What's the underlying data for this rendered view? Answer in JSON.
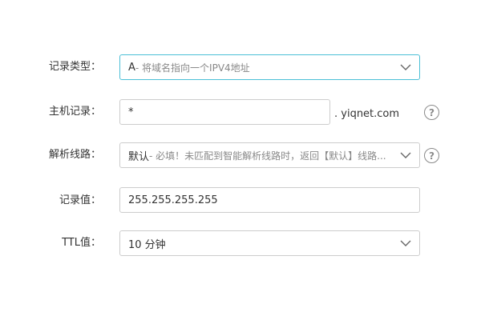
{
  "form": {
    "record_type": {
      "label": "记录类型：",
      "main": "A",
      "desc": " - 将域名指向一个IPV4地址"
    },
    "host": {
      "label": "主机记录：",
      "value": "*",
      "suffix": ". yiqnet.com",
      "help": "?"
    },
    "line": {
      "label": "解析线路：",
      "main": "默认",
      "desc": " - 必填！未匹配到智能解析线路时，返回【默认】线路...",
      "help": "?"
    },
    "value": {
      "label": "记录值：",
      "value": "255.255.255.255"
    },
    "ttl": {
      "label": "TTL值：",
      "main": "10 分钟"
    }
  },
  "colors": {
    "focus_border": "#4bbfd6",
    "border": "#cccccc",
    "text": "#333333",
    "muted": "#888888"
  }
}
